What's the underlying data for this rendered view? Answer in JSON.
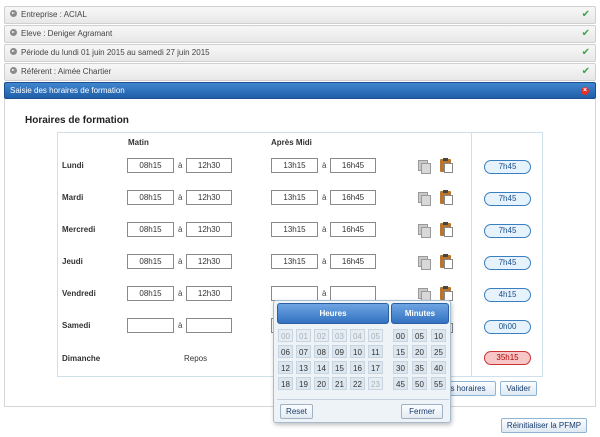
{
  "accordion": {
    "entreprise": "Entreprise : ACIAL",
    "eleve": "Eleve : Deniger Agramant",
    "periode": "Période du lundi 01 juin 2015 au samedi 27 juin 2015",
    "referent": "Référent : Aimée Chartier",
    "active": "Saisie des horaires de formation",
    "check_glyph": "✔",
    "close_glyph": "×"
  },
  "section_title": "Horaires de formation",
  "columns": {
    "matin": "Matin",
    "apres_midi": "Après Midi"
  },
  "separator": "à",
  "days": [
    {
      "label": "Lundi",
      "m1": "08h15",
      "m2": "12h30",
      "a1": "13h15",
      "a2": "16h45",
      "total": "7h45"
    },
    {
      "label": "Mardi",
      "m1": "08h15",
      "m2": "12h30",
      "a1": "13h15",
      "a2": "16h45",
      "total": "7h45"
    },
    {
      "label": "Mercredi",
      "m1": "08h15",
      "m2": "12h30",
      "a1": "13h15",
      "a2": "16h45",
      "total": "7h45"
    },
    {
      "label": "Jeudi",
      "m1": "08h15",
      "m2": "12h30",
      "a1": "13h15",
      "a2": "16h45",
      "total": "7h45"
    },
    {
      "label": "Vendredi",
      "m1": "08h15",
      "m2": "12h30",
      "a1": "",
      "a2": "",
      "total": "4h15"
    },
    {
      "label": "Samedi",
      "m1": "",
      "m2": "",
      "a1": "",
      "a2": "",
      "total": "0h00"
    }
  ],
  "dimanche": {
    "label": "Dimanche",
    "value": "Repos",
    "total": "35h15"
  },
  "buttons": {
    "horaires": "s horaires",
    "valider": "Valider",
    "reinit": "Réinitialiser la PFMP"
  },
  "picker": {
    "heures_label": "Heures",
    "minutes_label": "Minutes",
    "hours": [
      "00",
      "01",
      "02",
      "03",
      "04",
      "05",
      "06",
      "07",
      "08",
      "09",
      "10",
      "11",
      "12",
      "13",
      "14",
      "15",
      "16",
      "17",
      "18",
      "19",
      "20",
      "21",
      "22",
      "23"
    ],
    "hours_disabled": [
      "00",
      "01",
      "02",
      "03",
      "04",
      "05",
      "23"
    ],
    "minutes": [
      "00",
      "05",
      "10",
      "15",
      "20",
      "25",
      "30",
      "35",
      "40",
      "45",
      "50",
      "55"
    ],
    "reset": "Reset",
    "fermer": "Fermer"
  },
  "colors": {
    "accent": "#2a6bb8",
    "check": "#3aa44a",
    "total_bad": "#f7c6c6"
  }
}
